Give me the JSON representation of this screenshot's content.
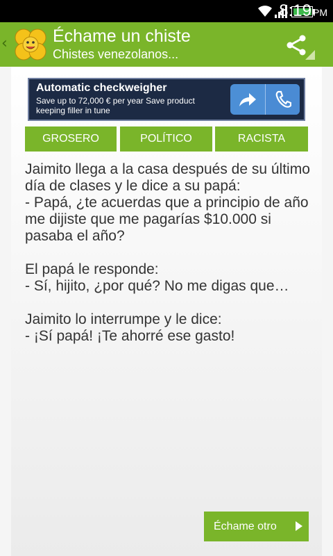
{
  "status_bar": {
    "time": "8:19",
    "ampm": "PM",
    "icons": [
      "wifi-icon",
      "signal-icon",
      "battery-icon"
    ]
  },
  "action_bar": {
    "title": "Échame un chiste",
    "subtitle": "Chistes venezolanos...",
    "icons": [
      "back-icon",
      "app-logo-icon",
      "share-icon"
    ],
    "color": "#7ab52a"
  },
  "ad": {
    "title": "Automatic checkweigher",
    "text": "Save up to 72,000 € per year Save product keeping filler in tune",
    "icons": [
      "forward-arrow-icon",
      "phone-icon"
    ]
  },
  "tabs": [
    {
      "label": "GROSERO"
    },
    {
      "label": "POLÍTICO"
    },
    {
      "label": "RACISTA"
    }
  ],
  "joke": {
    "text": "Jaimito llega a la casa después de su último día de clases y le dice a su papá:\n- Papá, ¿te acuerdas que a principio de año me dijiste que me pagarías $10.000 si pasaba el año?\n\nEl papá le responde:\n- Sí, hijito, ¿por qué? No me digas que…\n\nJaimito lo interrumpe y le dice:\n- ¡Sí papá! ¡Te ahorré ese gasto!"
  },
  "next_button": {
    "label": "Échame otro"
  }
}
